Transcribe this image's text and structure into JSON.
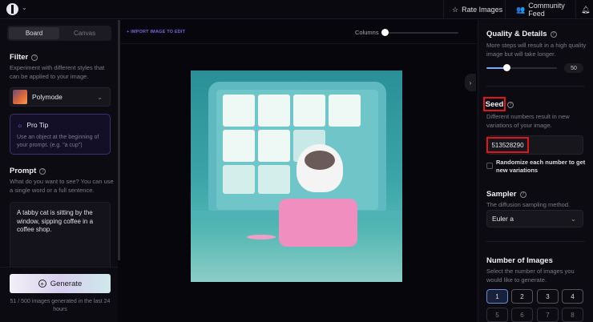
{
  "topbar": {
    "rate_images": "Rate Images",
    "community_feed": "Community Feed"
  },
  "left": {
    "tabs": [
      "Board",
      "Canvas"
    ],
    "filter": {
      "title": "Filter",
      "desc": "Experiment with different styles that can be applied to your image.",
      "selected": "Polymode"
    },
    "pro_tip": {
      "title": "Pro Tip",
      "text": "Use an object at the beginning of your prompt. (e.g. \"a cup\")"
    },
    "prompt": {
      "title": "Prompt",
      "desc": "What do you want to see? You can use a single word or a full sentence.",
      "value": "A tabby cat is sitting by the window, sipping coffee in a coffee shop."
    },
    "generate_label": "Generate",
    "usage": "51 / 500 images generated in the last 24 hours"
  },
  "center": {
    "import_label": "+ IMPORT IMAGE TO EDIT",
    "columns_label": "Columns"
  },
  "right": {
    "quality": {
      "title": "Quality & Details",
      "desc": "More steps will result in a high quality image but will take longer.",
      "value": "50",
      "fraction": 0.3
    },
    "seed": {
      "title": "Seed",
      "desc": "Different numbers result in new variations of your image.",
      "value": "513528290",
      "randomize_label": "Randomize each number to get new variations"
    },
    "sampler": {
      "title": "Sampler",
      "desc": "The diffusion sampling method.",
      "value": "Euler a"
    },
    "num_images": {
      "title": "Number of Images",
      "desc": "Select the number of images you would like to generate.",
      "options": [
        "1",
        "2",
        "3",
        "4",
        "5",
        "6",
        "7",
        "8"
      ],
      "selected": "1"
    }
  },
  "colors": {
    "accent": "#7a63e0",
    "highlight": "#e0141c"
  }
}
